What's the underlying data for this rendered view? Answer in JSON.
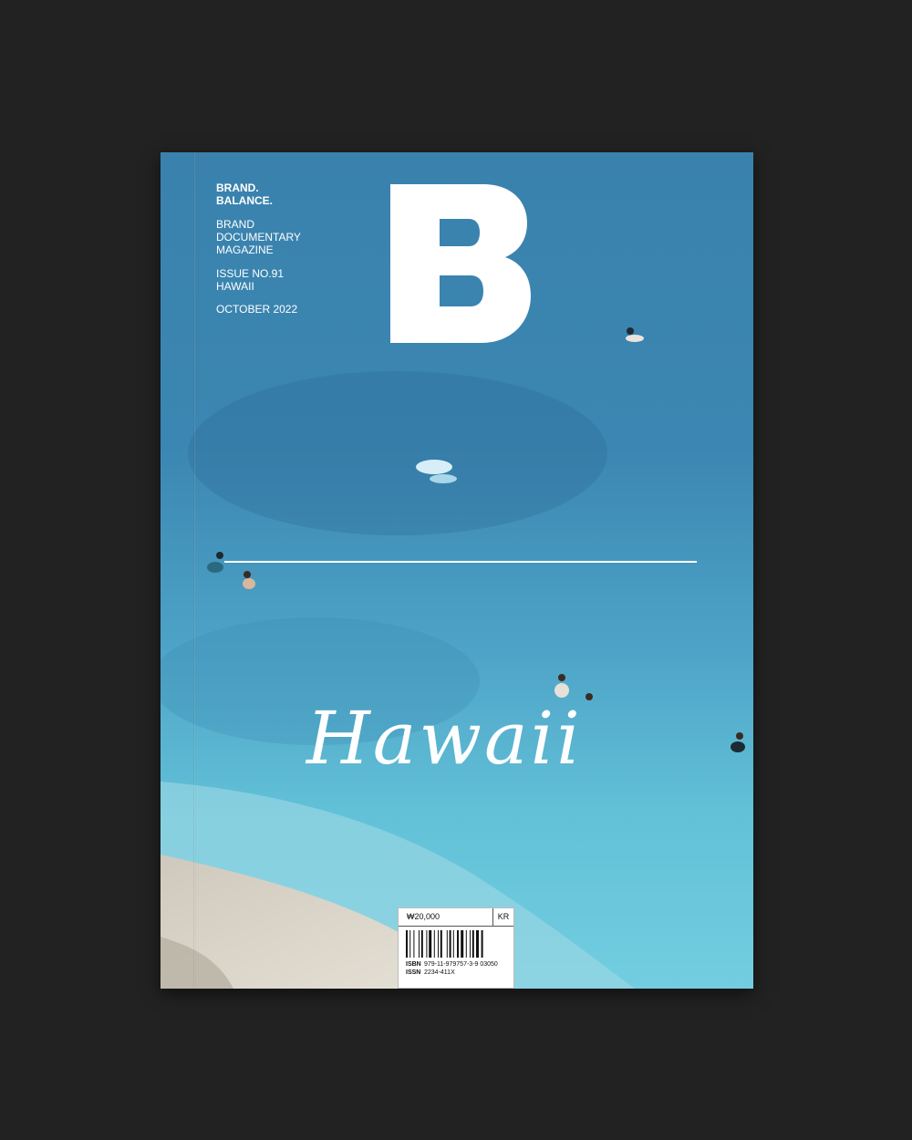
{
  "cover": {
    "tagline": [
      "BRAND.",
      "BALANCE."
    ],
    "subtitle": [
      "BRAND",
      "DOCUMENTARY",
      "MAGAZINE"
    ],
    "issue": [
      "ISSUE NO.91",
      "HAWAII"
    ],
    "date": "OCTOBER 2022",
    "logo_letter": "B",
    "title": "Hawaii"
  },
  "barcode": {
    "price": "₩20,000",
    "region": "KR",
    "isbn_label": "ISBN",
    "isbn": "979-11-979757-3-9 03050",
    "issn_label": "ISSN",
    "issn": "2234-411X"
  },
  "colors": {
    "background": "#222222",
    "sea_deep": "#3d86b0",
    "sea_shallow": "#5ec0d6",
    "sand": "#d8d2c6",
    "ink": "#ffffff"
  }
}
